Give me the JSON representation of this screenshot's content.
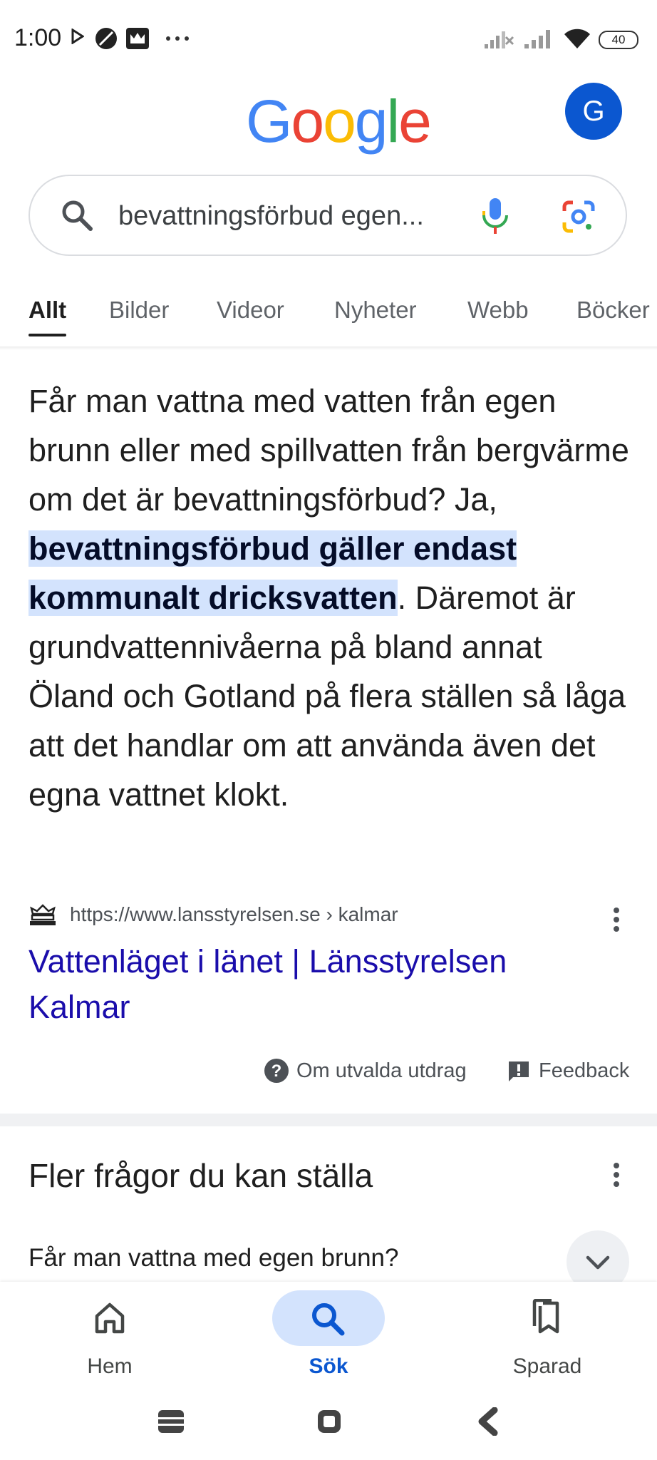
{
  "status_bar": {
    "time": "1:00",
    "battery": "40"
  },
  "header": {
    "logo": "Google",
    "avatar_initial": "G"
  },
  "search": {
    "query": "bevattningsförbud egen..."
  },
  "tabs": [
    {
      "label": "Allt",
      "active": true
    },
    {
      "label": "Bilder"
    },
    {
      "label": "Videor"
    },
    {
      "label": "Nyheter"
    },
    {
      "label": "Webb"
    },
    {
      "label": "Böcker"
    }
  ],
  "snippet": {
    "text_before": "Får man vattna med vatten från egen brunn eller med spillvatten från bergvärme om det är bevattningsförbud? Ja, ",
    "highlight": "bevattningsförbud gäller endast kommunalt dricksvatten",
    "text_after": ". Däremot är grundvattennivåerna på bland annat Öland och Gotland på flera ställen så låga att det handlar om att använda även det egna vattnet klokt.",
    "source_url": "https://www.lansstyrelsen.se › kalmar",
    "result_title": "Vattenläget i länet | Länsstyrelsen Kalmar",
    "about_label": "Om utvalda utdrag",
    "feedback_label": "Feedback"
  },
  "paa": {
    "title": "Fler frågor du kan ställa",
    "questions": [
      "Får man vattna med egen brunn?"
    ]
  },
  "bottom_nav": {
    "items": [
      {
        "label": "Hem"
      },
      {
        "label": "Sök",
        "active": true
      },
      {
        "label": "Sparad"
      }
    ]
  },
  "colors": {
    "accent": "#0b57d0",
    "highlight": "#d3e3fd",
    "link": "#1a0dab"
  }
}
